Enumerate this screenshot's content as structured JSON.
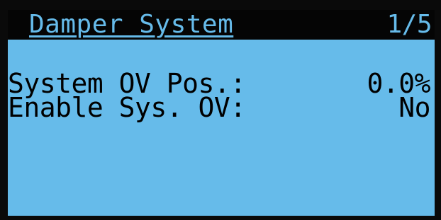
{
  "screen": {
    "title": "Damper System",
    "page_indicator": "1/5"
  },
  "rows": [
    {
      "label": "System OV Pos.:",
      "value": "0.0%"
    },
    {
      "label": "Enable Sys. OV:",
      "value": "No"
    }
  ],
  "colors": {
    "lcd_background": "#66bbea",
    "title_bar": "#050505",
    "text": "#000000"
  }
}
